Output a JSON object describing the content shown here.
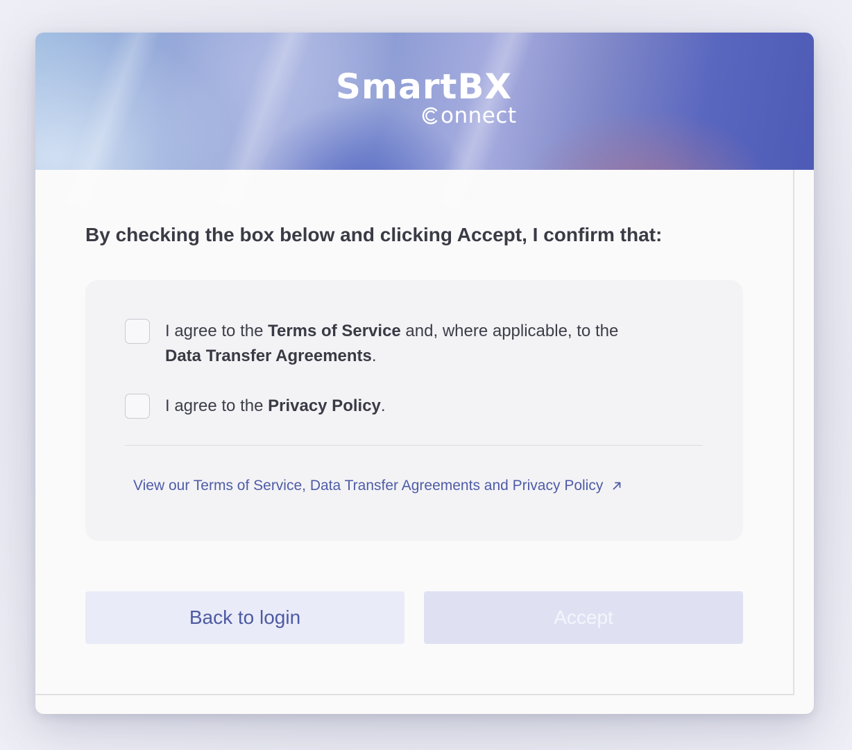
{
  "brand": {
    "name": "SmartBX",
    "sub": "onnect",
    "sub_icon": "c-ring-icon"
  },
  "heading": "By checking the box below and clicking Accept, I confirm that:",
  "consents": [
    {
      "pre": "I agree to the ",
      "bold1": "Terms of Service",
      "mid": " and, where applicable, to the ",
      "bold2": "Data Transfer Agreements",
      "post": ".",
      "checked": false
    },
    {
      "pre": "I agree to the ",
      "bold1": "Privacy Policy",
      "post": ".",
      "checked": false
    }
  ],
  "policy_link": {
    "label": "View our Terms of Service, Data Transfer Agreements and Privacy Policy",
    "icon": "external-link-arrow-icon"
  },
  "buttons": {
    "back": "Back to login",
    "accept": "Accept"
  },
  "colors": {
    "link": "#4e5ca6",
    "back_bg": "#e9ebf8",
    "accept_bg_disabled": "#dfe1f3"
  }
}
